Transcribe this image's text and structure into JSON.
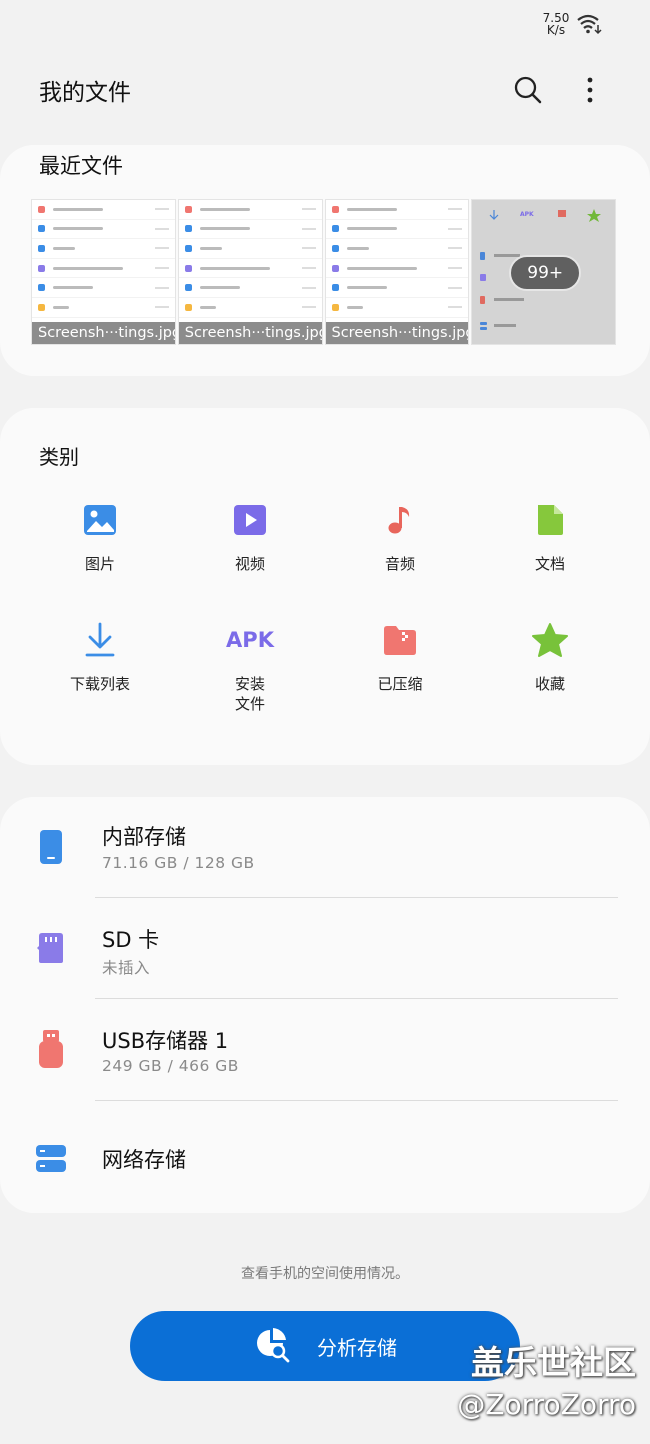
{
  "status": {
    "net_speed": "7.50\nK/s"
  },
  "header": {
    "title": "我的文件"
  },
  "recent": {
    "title": "最近文件",
    "files": [
      {
        "caption": "Screensh···tings.jpg"
      },
      {
        "caption": "Screensh···tings.jpg"
      },
      {
        "caption": "Screensh···tings.jpg"
      }
    ],
    "more_badge": "99+"
  },
  "categories": {
    "title": "类别",
    "items": [
      {
        "label": "图片",
        "icon": "image-icon",
        "color": "#3b8de6"
      },
      {
        "label": "视频",
        "icon": "video-icon",
        "color": "#7b6be8"
      },
      {
        "label": "音频",
        "icon": "music-icon",
        "color": "#e8655b"
      },
      {
        "label": "文档",
        "icon": "document-icon",
        "color": "#86c83c"
      },
      {
        "label": "下载列表",
        "icon": "download-icon",
        "color": "#3b8de6"
      },
      {
        "label": "安装\n文件",
        "icon": "apk-icon",
        "icon_text": "APK",
        "color": "#7b6be8"
      },
      {
        "label": "已压缩",
        "icon": "folder-zip-icon",
        "color": "#f07670"
      },
      {
        "label": "收藏",
        "icon": "star-icon",
        "color": "#78c23a"
      }
    ]
  },
  "storage": {
    "items": [
      {
        "name": "内部存储",
        "detail": "71.16 GB / 128 GB",
        "icon": "phone-icon",
        "color": "#3b8de6"
      },
      {
        "name": "SD 卡",
        "detail": "未插入",
        "icon": "sd-card-icon",
        "color": "#8a7be8"
      },
      {
        "name": "USB存储器 1",
        "detail": "249 GB / 466 GB",
        "icon": "usb-drive-icon",
        "color": "#f07670"
      },
      {
        "name": "网络存储",
        "icon": "network-storage-icon",
        "color": "#3b8de6"
      }
    ]
  },
  "footer": {
    "hint": "查看手机的空间使用情况。",
    "analyze_label": "分析存储"
  },
  "watermark": {
    "line1": "盖乐世社区",
    "line2": "@ZorroZorro"
  }
}
